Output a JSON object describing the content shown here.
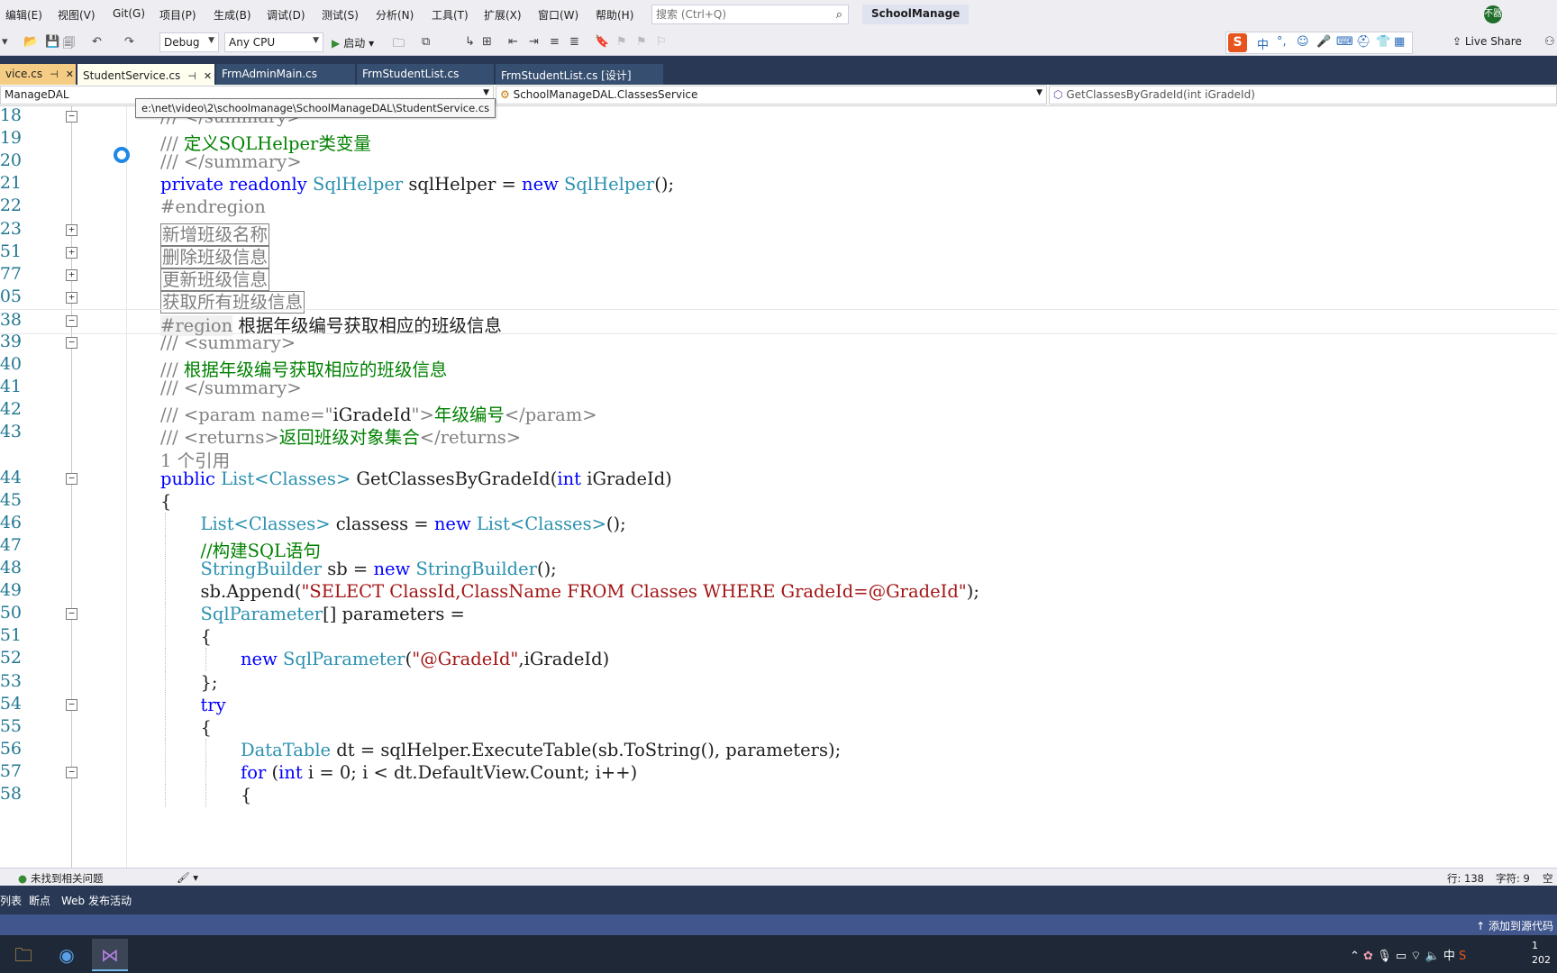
{
  "menu": {
    "items": [
      "编辑(E)",
      "视图(V)",
      "Git(G)",
      "项目(P)",
      "生成(B)",
      "调试(D)",
      "测试(S)",
      "分析(N)",
      "工具(T)",
      "扩展(X)",
      "窗口(W)",
      "帮助(H)"
    ],
    "search_placeholder": "搜索 (Ctrl+Q)",
    "solution_name": "SchoolManage",
    "user_initials": "不器"
  },
  "toolbar": {
    "configuration": "Debug",
    "platform": "Any CPU",
    "start_label": "启动",
    "live_share": "Live Share",
    "ime_chars": [
      "中",
      "°,",
      "☺",
      "🎤",
      "⌨",
      "⛑",
      "👕",
      "▦"
    ]
  },
  "tabs": [
    {
      "label": "vice.cs",
      "state": "active"
    },
    {
      "label": "StudentService.cs",
      "state": "open"
    },
    {
      "label": "FrmAdminMain.cs",
      "state": "inactive"
    },
    {
      "label": "FrmStudentList.cs",
      "state": "inactive"
    },
    {
      "label": "FrmStudentList.cs [设计]",
      "state": "inactive"
    }
  ],
  "navbar": {
    "project": "ManageDAL",
    "class": "SchoolManageDAL.ClassesService",
    "member": "GetClassesByGradeId(int iGradeId)",
    "tooltip": "e:\\net\\video\\2\\schoolmanage\\SchoolManageDAL\\StudentService.cs"
  },
  "lines": [
    {
      "n": "18",
      "fold": "−",
      "indent": 0,
      "tokens": [
        [
          "cg",
          "/// </summary>"
        ]
      ]
    },
    {
      "n": "19",
      "fold": "",
      "indent": 0,
      "tokens": [
        [
          "cg",
          "/// "
        ],
        [
          "cm",
          "定义SQLHelper类变量"
        ]
      ]
    },
    {
      "n": "20",
      "fold": "",
      "indent": 0,
      "tokens": [
        [
          "cg",
          "/// </summary>"
        ]
      ]
    },
    {
      "n": "21",
      "fold": "",
      "indent": 0,
      "tokens": [
        [
          "kw",
          "private"
        ],
        [
          "",
          " "
        ],
        [
          "kw",
          "readonly"
        ],
        [
          "",
          " "
        ],
        [
          "ty",
          "SqlHelper"
        ],
        [
          "",
          " sqlHelper = "
        ],
        [
          "kw",
          "new"
        ],
        [
          "",
          " "
        ],
        [
          "ty",
          "SqlHelper"
        ],
        [
          "",
          "();"
        ]
      ]
    },
    {
      "n": "22",
      "fold": "",
      "indent": 0,
      "tokens": [
        [
          "pp",
          "#endregion"
        ]
      ]
    },
    {
      "n": "23",
      "fold": "+",
      "indent": 0,
      "tokens": [
        [
          "collapsed",
          "新增班级名称"
        ]
      ]
    },
    {
      "n": "51",
      "fold": "+",
      "indent": 0,
      "tokens": [
        [
          "collapsed",
          "删除班级信息"
        ]
      ]
    },
    {
      "n": "77",
      "fold": "+",
      "indent": 0,
      "tokens": [
        [
          "collapsed",
          "更新班级信息"
        ]
      ]
    },
    {
      "n": "05",
      "fold": "+",
      "indent": 0,
      "tokens": [
        [
          "collapsed",
          "获取所有班级信息"
        ]
      ]
    },
    {
      "n": "38",
      "fold": "−",
      "indent": 0,
      "current": true,
      "tokens": [
        [
          "region-tag",
          "#region"
        ],
        [
          "",
          " 根据年级编号获取相应的班级信息"
        ]
      ]
    },
    {
      "n": "39",
      "fold": "−",
      "indent": 0,
      "tokens": [
        [
          "cg",
          "/// <summary>"
        ]
      ]
    },
    {
      "n": "40",
      "fold": "",
      "indent": 0,
      "tokens": [
        [
          "cg",
          "/// "
        ],
        [
          "cm",
          "根据年级编号获取相应的班级信息"
        ]
      ]
    },
    {
      "n": "41",
      "fold": "",
      "indent": 0,
      "tokens": [
        [
          "cg",
          "/// </summary>"
        ]
      ]
    },
    {
      "n": "42",
      "fold": "",
      "indent": 0,
      "tokens": [
        [
          "cg",
          "/// <param name=\""
        ],
        [
          "",
          "iGradeId"
        ],
        [
          "cg",
          "\">"
        ],
        [
          "cm",
          "年级编号"
        ],
        [
          "cg",
          "</param>"
        ]
      ]
    },
    {
      "n": "43",
      "fold": "",
      "indent": 0,
      "tokens": [
        [
          "cg",
          "/// <returns>"
        ],
        [
          "cm",
          "返回班级对象集合"
        ],
        [
          "cg",
          "</returns>"
        ]
      ]
    },
    {
      "n": "",
      "fold": "",
      "indent": 0,
      "tokens": [
        [
          "cg",
          "1 个引用"
        ]
      ]
    },
    {
      "n": "44",
      "fold": "−",
      "indent": 0,
      "tokens": [
        [
          "kw",
          "public"
        ],
        [
          "",
          " "
        ],
        [
          "ty",
          "List<Classes>"
        ],
        [
          "",
          " GetClassesByGradeId("
        ],
        [
          "kw",
          "int"
        ],
        [
          "",
          " iGradeId)"
        ]
      ]
    },
    {
      "n": "45",
      "fold": "",
      "indent": 0,
      "tokens": [
        [
          "",
          "{"
        ]
      ]
    },
    {
      "n": "46",
      "fold": "",
      "indent": 1,
      "tokens": [
        [
          "ty",
          "List<Classes>"
        ],
        [
          "",
          " classess = "
        ],
        [
          "kw",
          "new"
        ],
        [
          "",
          " "
        ],
        [
          "ty",
          "List<Classes>"
        ],
        [
          "",
          "();"
        ]
      ]
    },
    {
      "n": "47",
      "fold": "",
      "indent": 1,
      "tokens": [
        [
          "cm",
          "//构建SQL语句"
        ]
      ]
    },
    {
      "n": "48",
      "fold": "",
      "indent": 1,
      "tokens": [
        [
          "ty",
          "StringBuilder"
        ],
        [
          "",
          " sb = "
        ],
        [
          "kw",
          "new"
        ],
        [
          "",
          " "
        ],
        [
          "ty",
          "StringBuilder"
        ],
        [
          "",
          "();"
        ]
      ]
    },
    {
      "n": "49",
      "fold": "",
      "indent": 1,
      "tokens": [
        [
          "",
          "sb.Append("
        ],
        [
          "st",
          "\"SELECT ClassId,ClassName FROM Classes WHERE GradeId=@GradeId\""
        ],
        [
          "",
          ");"
        ]
      ]
    },
    {
      "n": "50",
      "fold": "−",
      "indent": 1,
      "tokens": [
        [
          "ty",
          "SqlParameter"
        ],
        [
          "",
          "[] parameters ="
        ]
      ]
    },
    {
      "n": "51",
      "fold": "",
      "indent": 1,
      "tokens": [
        [
          "",
          "{"
        ]
      ]
    },
    {
      "n": "52",
      "fold": "",
      "indent": 2,
      "tokens": [
        [
          "kw",
          "new"
        ],
        [
          "",
          " "
        ],
        [
          "ty",
          "SqlParameter"
        ],
        [
          "",
          "("
        ],
        [
          "st",
          "\"@GradeId\""
        ],
        [
          "",
          ",iGradeId)"
        ]
      ]
    },
    {
      "n": "53",
      "fold": "",
      "indent": 1,
      "tokens": [
        [
          "",
          "};"
        ]
      ]
    },
    {
      "n": "54",
      "fold": "−",
      "indent": 1,
      "tokens": [
        [
          "kw",
          "try"
        ]
      ]
    },
    {
      "n": "55",
      "fold": "",
      "indent": 1,
      "tokens": [
        [
          "",
          "{"
        ]
      ]
    },
    {
      "n": "56",
      "fold": "",
      "indent": 2,
      "tokens": [
        [
          "ty",
          "DataTable"
        ],
        [
          "",
          " dt = sqlHelper.ExecuteTable(sb.ToString(), parameters);"
        ]
      ]
    },
    {
      "n": "57",
      "fold": "−",
      "indent": 2,
      "tokens": [
        [
          "kw",
          "for"
        ],
        [
          "",
          " ("
        ],
        [
          "kw",
          "int"
        ],
        [
          "",
          " i = 0; i < dt.DefaultView.Count; i++)"
        ]
      ]
    },
    {
      "n": "58",
      "fold": "",
      "indent": 2,
      "tokens": [
        [
          "",
          "{"
        ]
      ]
    }
  ],
  "status": {
    "issues": "未找到相关问题",
    "line": "行: 138",
    "col": "字符: 9",
    "space": "空格"
  },
  "bottom_tabs": [
    "列表",
    "断点",
    "Web 发布活动"
  ],
  "vs_status": {
    "source_control": "添加到源代码"
  },
  "tray": {
    "ime": "中",
    "time": "1",
    "date": "202"
  }
}
